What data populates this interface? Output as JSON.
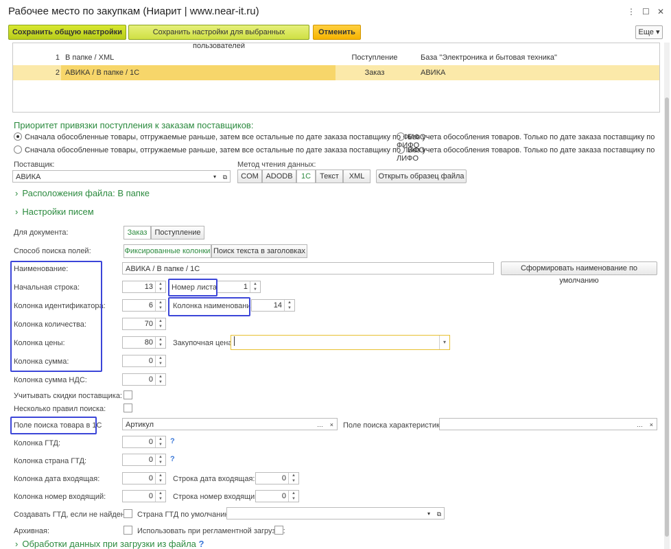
{
  "window": {
    "title": "Рабочее место по закупкам (Ниарит | www.near-it.ru)",
    "menu_icon": "⋮",
    "maximize_icon": "☐",
    "close_icon": "✕"
  },
  "toolbar": {
    "save_general": "Сохранить общую настройки",
    "save_selected": "Сохранить настройки для выбранных пользователей",
    "cancel": "Отменить",
    "more": "Еще ▾"
  },
  "table": {
    "rows": [
      {
        "num": "1",
        "name": "В папке / XML",
        "type": "Поступление",
        "base": "База \"Электроника и бытовая техника\""
      },
      {
        "num": "2",
        "name": "АВИКА / В папке / 1С",
        "type": "Заказ",
        "base": "АВИКА"
      }
    ]
  },
  "priority": {
    "heading": "Приоритет привязки поступления к заказам поставщиков:",
    "opt1": "Сначала обособленные товары, отгружаемые раньше, затем все остальные по дате заказа поставщику по ФИФО",
    "opt2": "Без учета обособления товаров. Только по дате заказа поставщику по ФИФО",
    "opt3": "Сначала обособленные товары, отгружаемые раньше, затем все остальные по дате заказа поставщику по ЛИФО",
    "opt4": "Без учета обособления товаров. Только по дате заказа поставщику по ЛИФО"
  },
  "supplier": {
    "label": "Поставщик:",
    "value": "АВИКА"
  },
  "read_method": {
    "label": "Метод чтения данных:",
    "options": [
      "COM",
      "ADODB",
      "1С",
      "Текст",
      "XML"
    ],
    "open_sample": "Открыть образец файла"
  },
  "sections": {
    "file_location": "Расположения файла: В папке",
    "mail_settings": "Настройки писем",
    "processing": "Обработки данных при загрузки из файла"
  },
  "doc": {
    "label": "Для документа:",
    "opt1": "Заказ",
    "opt2": "Поступление"
  },
  "search_method": {
    "label": "Способ поиска полей:",
    "opt1": "Фиксированные колонки",
    "opt2": "Поиск текста в заголовках"
  },
  "naming": {
    "label": "Наименование:",
    "value": "АВИКА / В папке / 1С",
    "button": "Сформировать наименование по умолчанию"
  },
  "fields": {
    "start_row": {
      "label": "Начальная строка:",
      "value": "13"
    },
    "sheet_num": {
      "label": "Номер листа",
      "value": "1"
    },
    "id_col": {
      "label": "Колонка идентификатора:",
      "value": "6"
    },
    "name_col": {
      "label": "Колонка наименования",
      "value": "14"
    },
    "qty_col": {
      "label": "Колонка количества:",
      "value": "70"
    },
    "price_col": {
      "label": "Колонка цены:",
      "value": "80"
    },
    "purchase_price": {
      "label": "Закупочная цена:",
      "value": ""
    },
    "sum_col": {
      "label": "Колонка сумма:",
      "value": "0"
    },
    "vat_col": {
      "label": "Колонка сумма НДС:",
      "value": "0"
    },
    "discount": {
      "label": "Учитывать скидки поставщика:"
    },
    "multi_rules": {
      "label": "Несколько правил поиска:"
    },
    "search_field": {
      "label": "Поле поиска товара в 1С",
      "value": "Артикул"
    },
    "char_search": {
      "label": "Поле поиска характеристики:",
      "value": ""
    },
    "gtd_col": {
      "label": "Колонка ГТД:",
      "value": "0"
    },
    "gtd_country_col": {
      "label": "Колонка страна ГТД:",
      "value": "0"
    },
    "in_date_col": {
      "label": "Колонка дата входящая:",
      "value": "0"
    },
    "in_date_row": {
      "label": "Строка дата входящая:",
      "value": "0"
    },
    "in_num_col": {
      "label": "Колонка номер входящий:",
      "value": "0"
    },
    "in_num_row": {
      "label": "Строка номер входящий:",
      "value": "0"
    },
    "create_gtd": {
      "label": "Создавать ГТД, если не найдена:"
    },
    "gtd_country_default": {
      "label": "Страна ГТД по умолчанию:",
      "value": ""
    },
    "archive": {
      "label": "Архивная:"
    },
    "use_regular": {
      "label": "Использовать при регламентной загрузке:"
    }
  },
  "help_mark": "?"
}
